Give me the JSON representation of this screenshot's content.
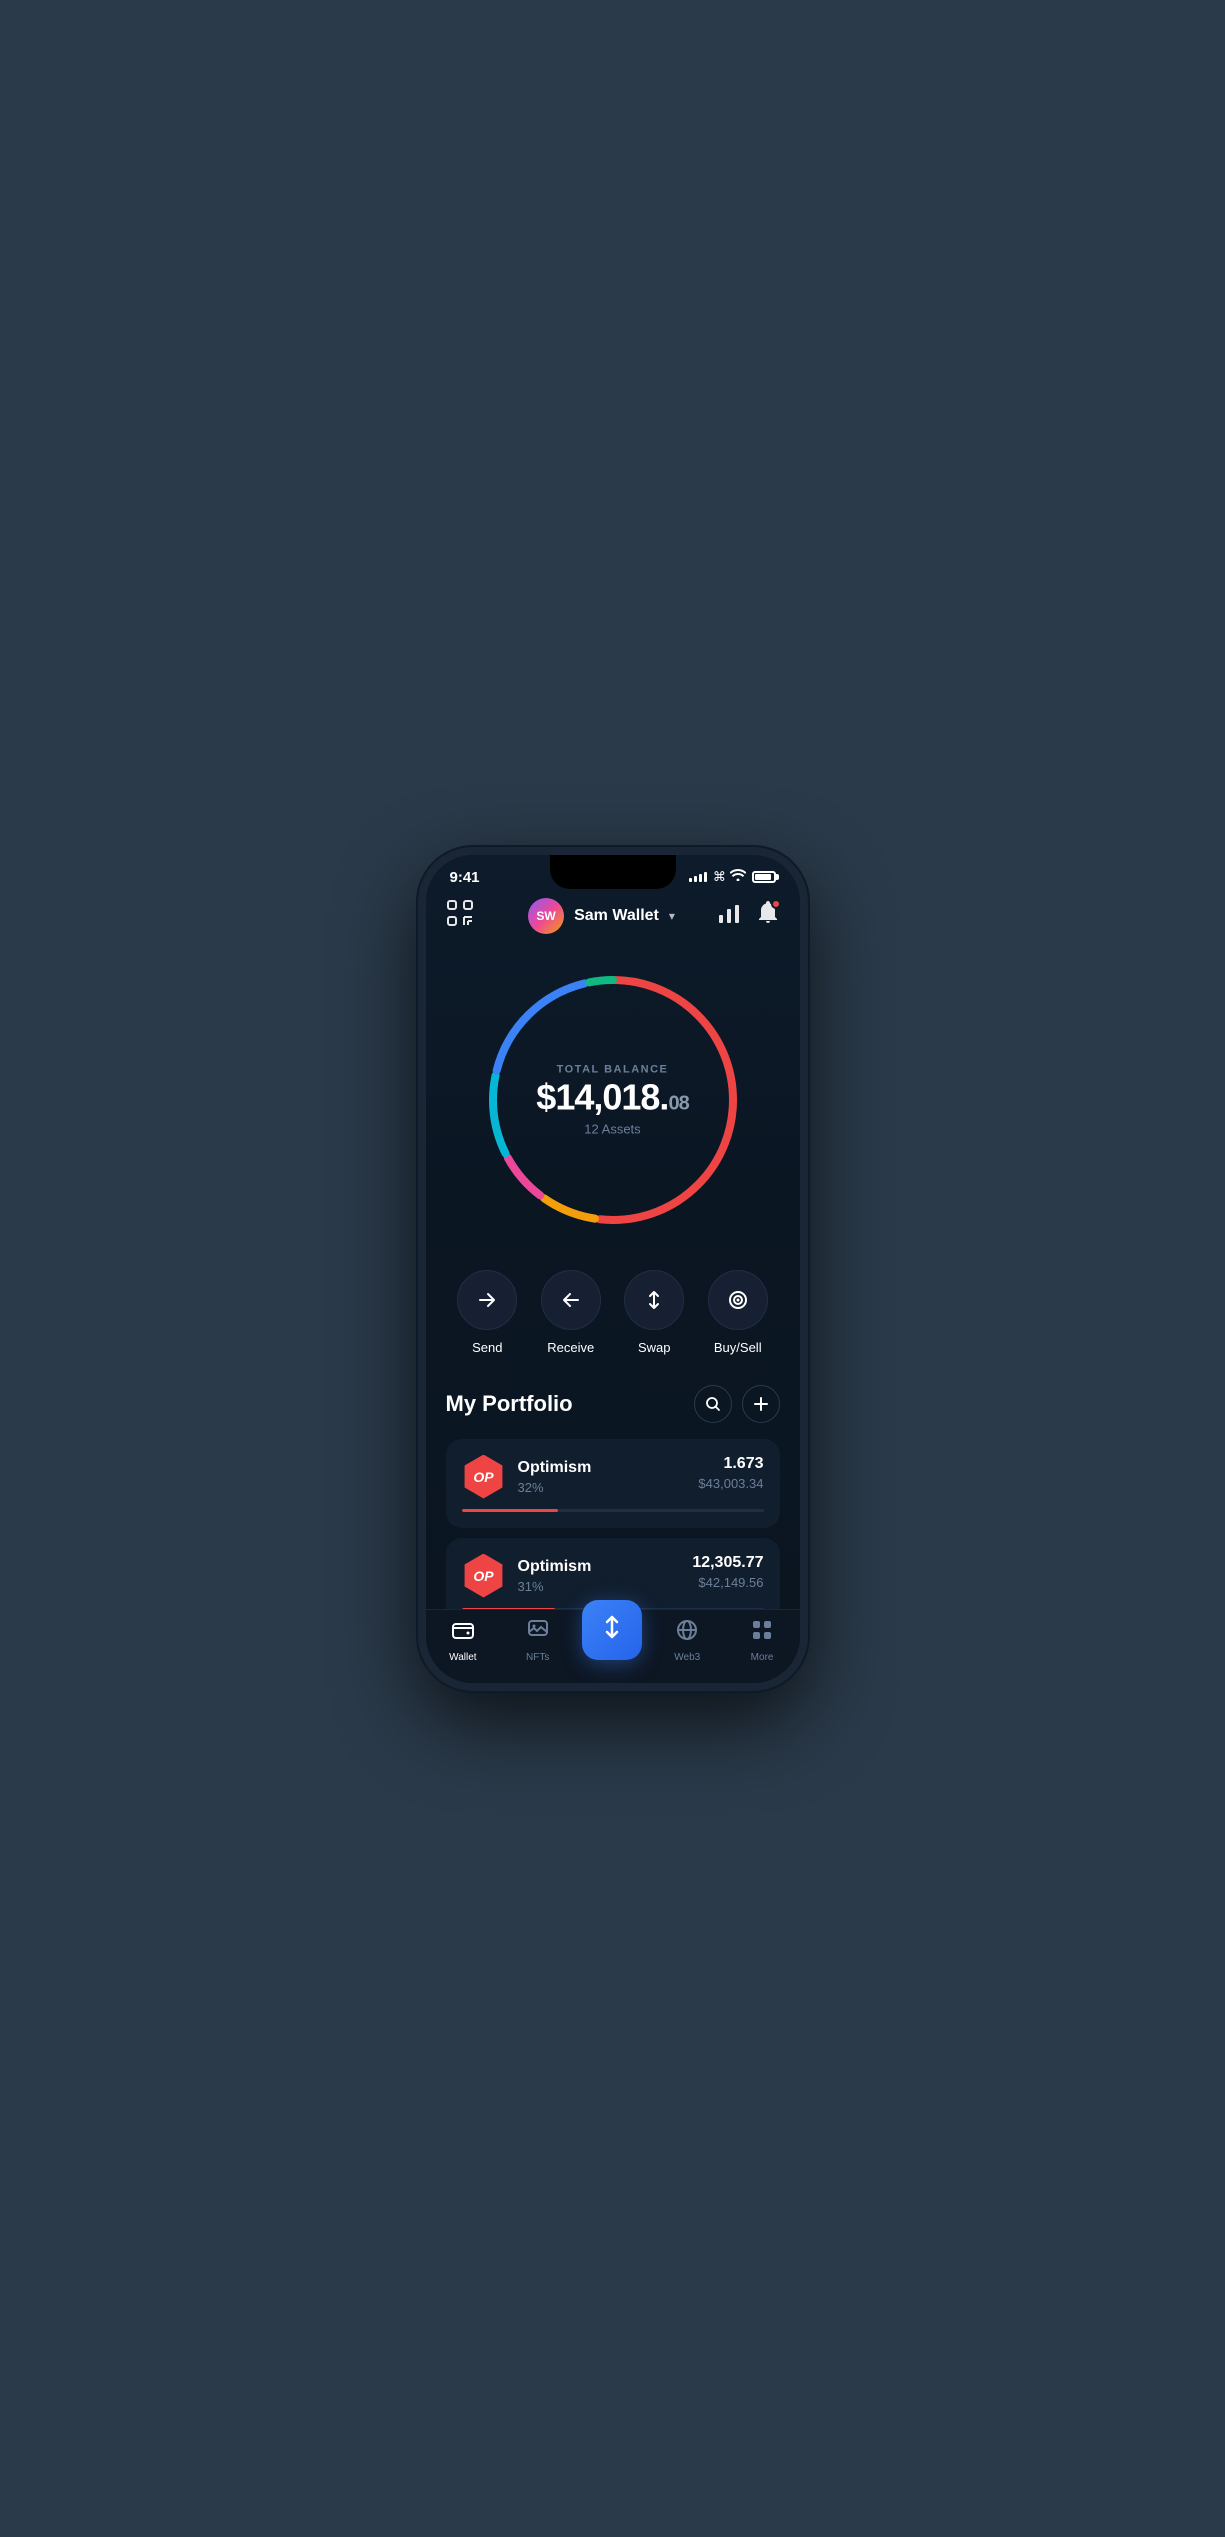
{
  "statusBar": {
    "time": "9:41",
    "signalBars": [
      3,
      5,
      7,
      9,
      11
    ],
    "batteryLevel": 90
  },
  "header": {
    "scanIcon": "⊡",
    "avatarInitials": "SW",
    "walletName": "Sam Wallet",
    "chartIcon": "📊",
    "bellIcon": "🔔"
  },
  "balance": {
    "label": "TOTAL BALANCE",
    "mainAmount": "$14,018.",
    "cents": "08",
    "assets": "12 Assets"
  },
  "actions": [
    {
      "id": "send",
      "icon": "→",
      "label": "Send"
    },
    {
      "id": "receive",
      "icon": "←",
      "label": "Receive"
    },
    {
      "id": "swap",
      "icon": "⇅",
      "label": "Swap"
    },
    {
      "id": "buysell",
      "icon": "◎",
      "label": "Buy/Sell"
    }
  ],
  "portfolio": {
    "title": "My Portfolio",
    "searchIcon": "🔍",
    "addIcon": "+",
    "items": [
      {
        "id": "op1",
        "name": "Optimism",
        "symbol": "OP",
        "percentage": "32%",
        "amount": "1.673",
        "usdValue": "$43,003.34",
        "progressWidth": 32,
        "progressColor": "#ef4444"
      },
      {
        "id": "op2",
        "name": "Optimism",
        "symbol": "OP",
        "percentage": "31%",
        "amount": "12,305.77",
        "usdValue": "$42,149.56",
        "progressWidth": 31,
        "progressColor": "#ef4444"
      }
    ]
  },
  "bottomNav": {
    "items": [
      {
        "id": "wallet",
        "label": "Wallet",
        "active": true
      },
      {
        "id": "nfts",
        "label": "NFTs",
        "active": false
      },
      {
        "id": "center",
        "label": "",
        "active": false,
        "isCenter": true
      },
      {
        "id": "web3",
        "label": "Web3",
        "active": false
      },
      {
        "id": "more",
        "label": "More",
        "active": false
      }
    ]
  },
  "ring": {
    "segments": [
      {
        "color": "#ef4444",
        "dashoffset": 20,
        "dasharray": "250 800"
      },
      {
        "color": "#f59e0b",
        "dashoffset": -235,
        "dasharray": "60 800"
      },
      {
        "color": "#ec4899",
        "dashoffset": -175,
        "dasharray": "55 800"
      },
      {
        "color": "#06b6d4",
        "dashoffset": 70,
        "dasharray": "120 800"
      },
      {
        "color": "#3b82f6",
        "dashoffset": -100,
        "dasharray": "180 800"
      },
      {
        "color": "#10b981",
        "dashoffset": -400,
        "dasharray": "150 800"
      }
    ]
  }
}
